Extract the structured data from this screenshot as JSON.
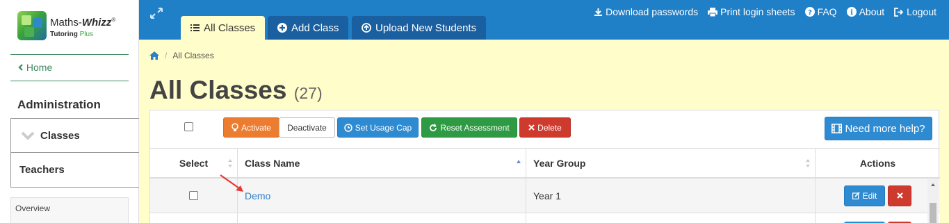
{
  "brand": {
    "name_part1": "Maths-",
    "name_part2": "Whizz",
    "reg": "®",
    "sub_part1": "Tutoring",
    "sub_part2": "Plus"
  },
  "sidebar": {
    "home": "Home",
    "section_title": "Administration",
    "items": [
      {
        "label": "Classes"
      },
      {
        "label": "Teachers"
      }
    ],
    "overview": "Overview"
  },
  "header": {
    "tabs": [
      {
        "label": "All Classes"
      },
      {
        "label": "Add Class"
      },
      {
        "label": "Upload New Students"
      }
    ],
    "links": [
      {
        "label": "Download passwords"
      },
      {
        "label": "Print login sheets"
      },
      {
        "label": "FAQ"
      },
      {
        "label": "About"
      },
      {
        "label": "Logout"
      }
    ]
  },
  "breadcrumb": {
    "current": "All Classes"
  },
  "page": {
    "title": "All Classes",
    "count": "(27)"
  },
  "toolbar": {
    "activate": "Activate",
    "deactivate": "Deactivate",
    "usage_cap": "Set Usage Cap",
    "reset": "Reset Assessment",
    "delete": "Delete",
    "help": "Need more help?"
  },
  "table": {
    "columns": [
      "Select",
      "Class Name",
      "Year Group",
      "Actions"
    ],
    "rows": [
      {
        "class_name": "Demo",
        "year_group": "Year 1",
        "edit": "Edit"
      }
    ]
  },
  "colors": {
    "header_blue": "#1f7fc7",
    "content_yellow": "#fffdc9",
    "accent_green": "#3d8a5f"
  }
}
